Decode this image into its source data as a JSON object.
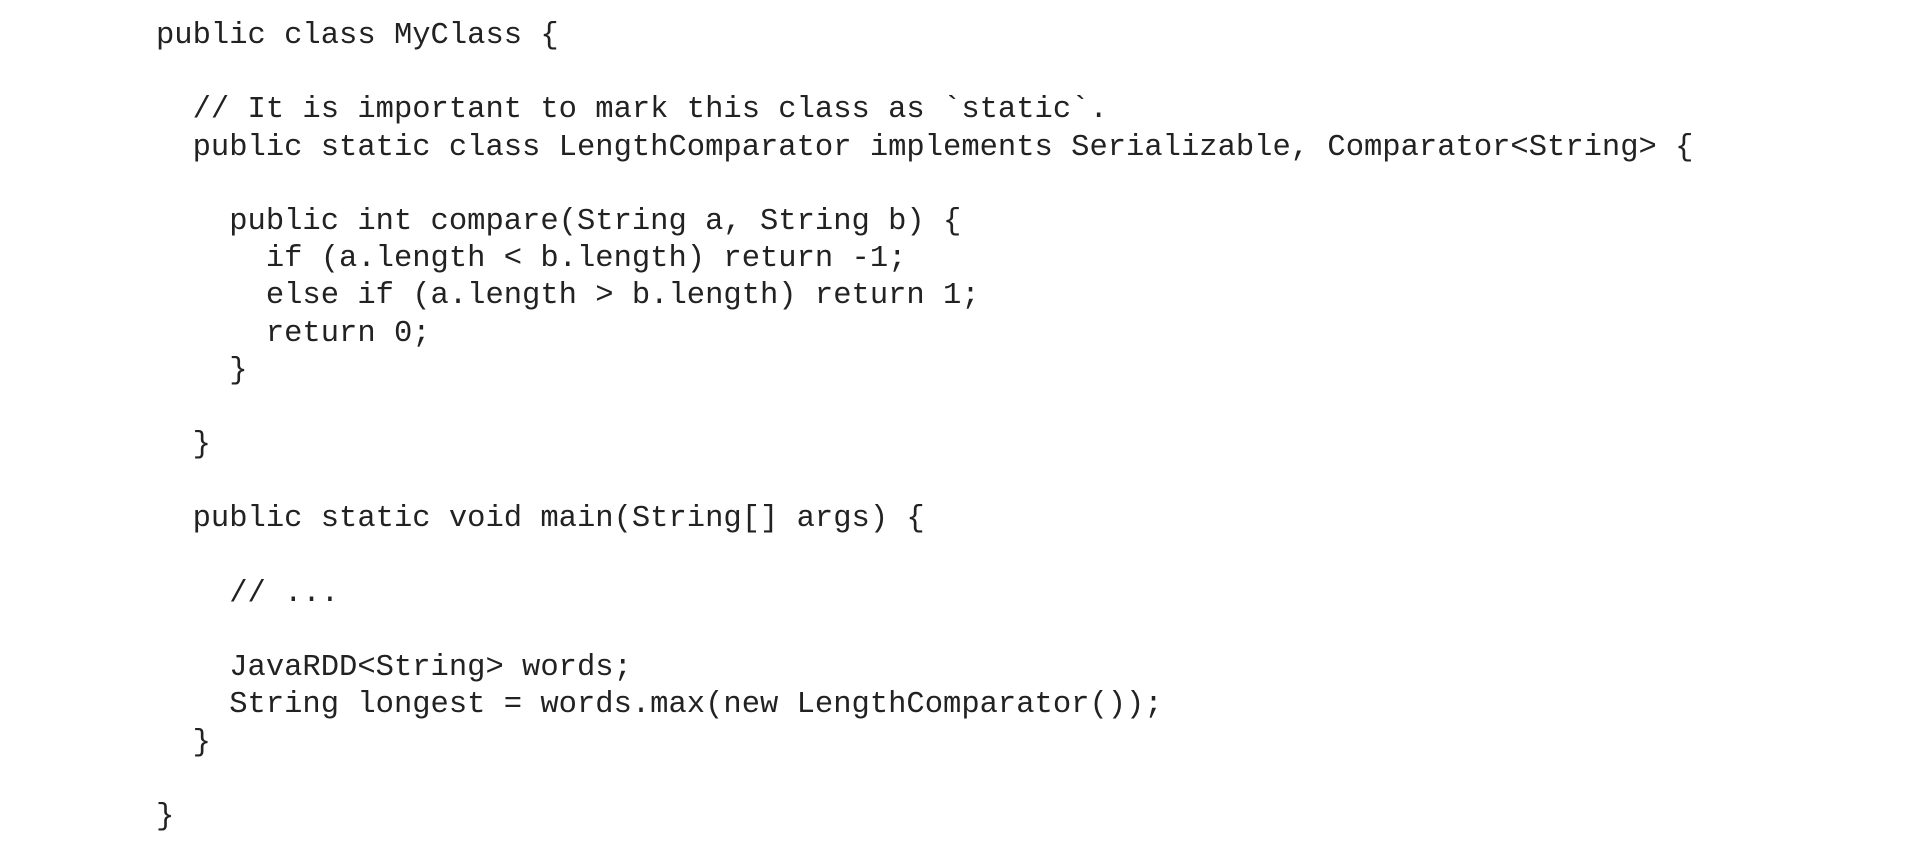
{
  "code": {
    "lines": [
      "public class MyClass {",
      "",
      "  // It is important to mark this class as `static`.",
      "  public static class LengthComparator implements Serializable, Comparator<String> {",
      "",
      "    public int compare(String a, String b) {",
      "      if (a.length < b.length) return -1;",
      "      else if (a.length > b.length) return 1;",
      "      return 0;",
      "    }",
      "",
      "  }",
      "",
      "  public static void main(String[] args) {",
      "",
      "    // ...",
      "",
      "    JavaRDD<String> words;",
      "    String longest = words.max(new LengthComparator());",
      "  }",
      "",
      "}"
    ]
  }
}
